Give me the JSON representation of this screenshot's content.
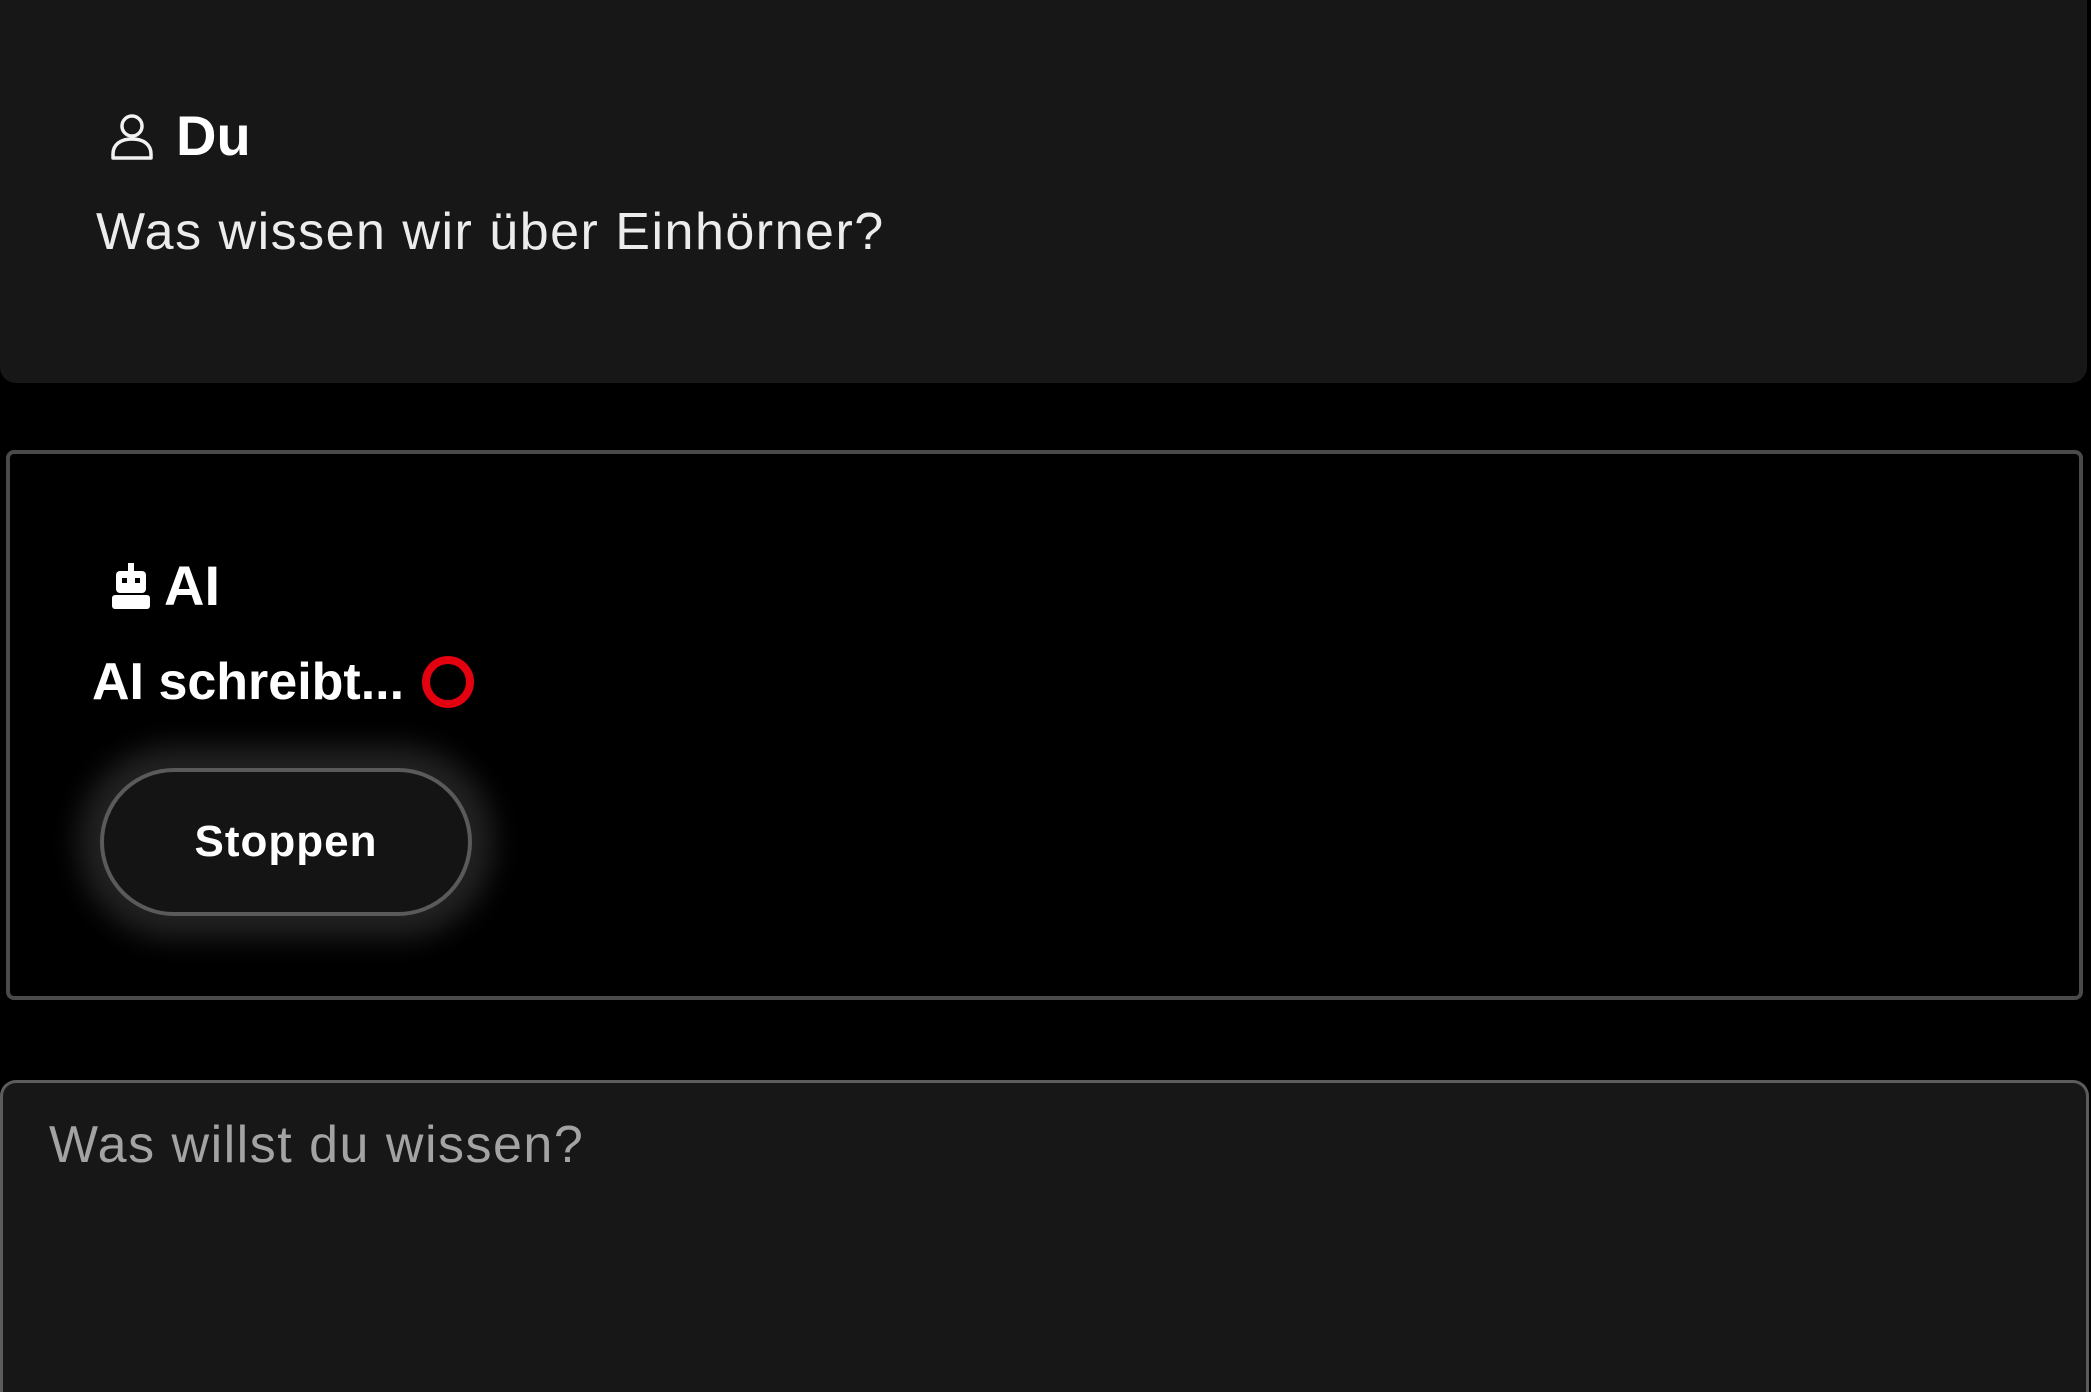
{
  "conversation": {
    "user": {
      "name": "Du",
      "icon": "user-icon",
      "message": "Was wissen wir über Einhörner?"
    },
    "ai": {
      "name": "AI",
      "icon": "robot-icon",
      "status": "AI schreibt...",
      "stop_label": "Stoppen",
      "spinner_color": "#e3000f"
    }
  },
  "composer": {
    "placeholder": "Was willst du wissen?",
    "value": ""
  },
  "colors": {
    "background": "#000000",
    "user_panel": "#171717",
    "ai_border": "#4a4a4a",
    "accent": "#e3000f"
  }
}
